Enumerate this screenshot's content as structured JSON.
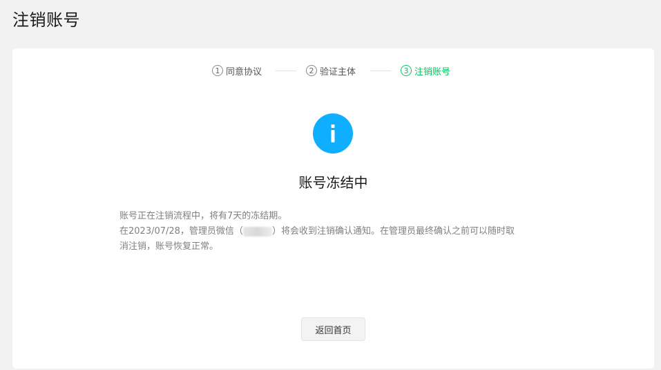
{
  "page": {
    "title": "注销账号"
  },
  "steps": [
    {
      "num": "1",
      "label": "同意协议",
      "state": "done"
    },
    {
      "num": "2",
      "label": "验证主体",
      "state": "done"
    },
    {
      "num": "3",
      "label": "注销账号",
      "state": "active"
    }
  ],
  "status": {
    "icon": "info-icon",
    "icon_color": "#10aeff",
    "title": "账号冻结中"
  },
  "description": {
    "line1": "账号正在注销流程中，将有7天的冻结期。",
    "line2_prefix": "在2023/07/28，管理员微信（",
    "line2_suffix": "）将会收到注销确认通知。在管理员最终确认之前可以随时取",
    "line3": "消注销，账号恢复正常。"
  },
  "actions": {
    "back_home": "返回首页"
  },
  "colors": {
    "accent": "#07c160",
    "background": "#f2f2f2"
  }
}
